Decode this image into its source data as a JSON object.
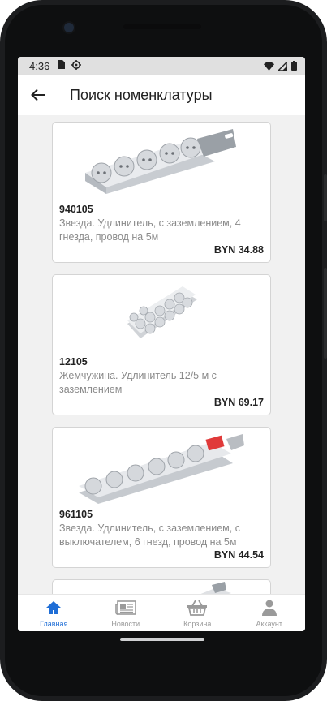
{
  "status": {
    "time": "4:36"
  },
  "appbar": {
    "title": "Поиск номенклатуры"
  },
  "products": [
    {
      "code": "940105",
      "description": "Звезда. Удлинитель, с заземлением, 4 гнезда, провод на 5м",
      "price": "BYN 34.88"
    },
    {
      "code": "12105",
      "description": "Жемчужина. Удлинитель 12/5 м с заземлением",
      "price": "BYN 69.17"
    },
    {
      "code": "961105",
      "description": "Звезда. Удлинитель, с заземлением, с выключателем, 6 гнезд, провод на 5м",
      "price": "BYN 44.54"
    }
  ],
  "nav": {
    "items": [
      {
        "label": "Главная",
        "icon": "home-icon",
        "active": true
      },
      {
        "label": "Новости",
        "icon": "newspaper-icon",
        "active": false
      },
      {
        "label": "Корзина",
        "icon": "basket-icon",
        "active": false
      },
      {
        "label": "Аккаунт",
        "icon": "person-icon",
        "active": false
      }
    ]
  },
  "colors": {
    "accent": "#1f6ed6",
    "inactive": "#9a9a9a",
    "list_bg": "#f1f1f1"
  }
}
